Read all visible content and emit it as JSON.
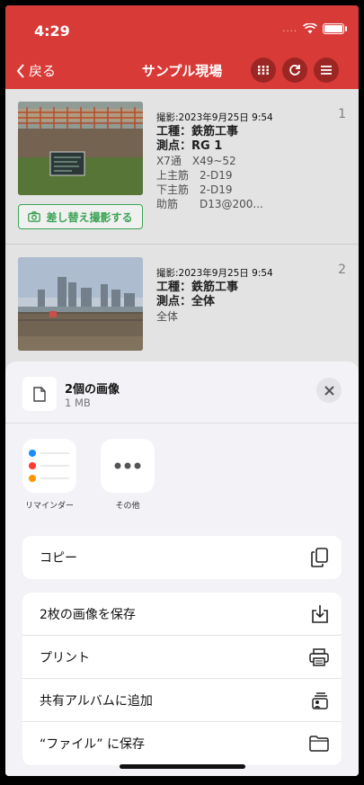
{
  "status_bar": {
    "time": "4:29",
    "signal_dots": "...."
  },
  "nav": {
    "back_label": "戻る",
    "title": "サンプル現場"
  },
  "photos": [
    {
      "index": "1",
      "date": "撮影:2023年9月25日 9:54",
      "kind": "工種：鉄筋工事",
      "point": "測点：RG 1",
      "lines": [
        "X7通　X49~52",
        "上主筋　2-D19",
        "下主筋　2-D19",
        "助筋　　D13@200..."
      ],
      "reshoot_label": "差し替え撮影する"
    },
    {
      "index": "2",
      "date": "撮影:2023年9月25日 9:54",
      "kind": "工種：鉄筋工事",
      "point": "測点：全体",
      "lines": [
        "全体"
      ],
      "reshoot_label": ""
    }
  ],
  "share_sheet": {
    "title": "2個の画像",
    "size": "1 MB",
    "apps": [
      {
        "label": "リマインダー",
        "icon": "reminders-icon"
      },
      {
        "label": "その他",
        "icon": "more-icon"
      }
    ],
    "copy_label": "コピー",
    "actions": [
      {
        "label": "2枚の画像を保存",
        "icon": "save-download-icon"
      },
      {
        "label": "プリント",
        "icon": "printer-icon"
      },
      {
        "label": "共有アルバムに追加",
        "icon": "shared-album-icon"
      },
      {
        "label": "“ファイル” に保存",
        "icon": "folder-icon"
      }
    ]
  },
  "colors": {
    "header": "#d83a37",
    "accent_green": "#3fae59"
  }
}
